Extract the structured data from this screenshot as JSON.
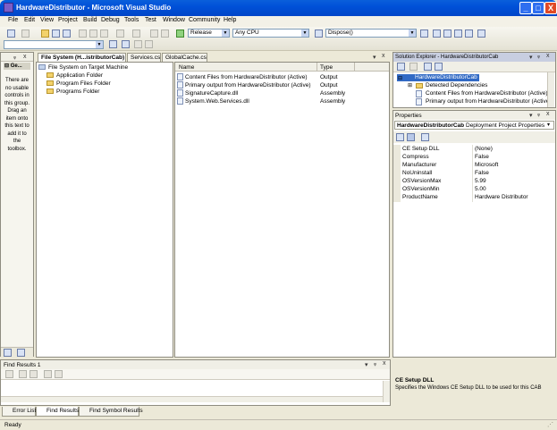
{
  "window": {
    "title": "HardwareDistributor - Microsoft Visual Studio",
    "minimize": "_",
    "maximize": "□",
    "close": "X"
  },
  "menu": [
    "File",
    "Edit",
    "View",
    "Project",
    "Build",
    "Debug",
    "Tools",
    "Test",
    "Window",
    "Community",
    "Help"
  ],
  "toolbar": {
    "configuration": "Release",
    "platform": "Any CPU",
    "find_value": "Dispose()"
  },
  "toolbox": {
    "tab_label": "Ge...",
    "empty_message": "There are no usable controls in this group. Drag an item onto this text to add it to the toolbox."
  },
  "editor_tabs": [
    {
      "label": "File System (H...istributorCab)"
    },
    {
      "label": "Services.cs"
    },
    {
      "label": "GlobalCache.cs"
    }
  ],
  "filesystem_tree": {
    "root": "File System on Target Machine",
    "children": [
      "Application Folder",
      "Program Files Folder",
      "Programs Folder"
    ]
  },
  "file_list": {
    "columns": [
      "Name",
      "Type"
    ],
    "rows": [
      {
        "name": "Content Files from HardwareDistributor (Active)",
        "type": "Output"
      },
      {
        "name": "Primary output from HardwareDistributor (Active)",
        "type": "Output"
      },
      {
        "name": "SignatureCapture.dll",
        "type": "Assembly"
      },
      {
        "name": "System.Web.Services.dll",
        "type": "Assembly"
      }
    ]
  },
  "solution_explorer": {
    "title": "Solution Explorer - HardwareDistributorCab",
    "project": "HardwareDistributorCab",
    "items": [
      "Detected Dependencies",
      "Content Files from HardwareDistributor (Active)",
      "Primary output from HardwareDistributor (Active)"
    ]
  },
  "properties": {
    "title": "Properties",
    "object_name": "HardwareDistributorCab",
    "object_type": "Deployment Project Properties",
    "rows": [
      {
        "name": "CE Setup DLL",
        "value": "(None)"
      },
      {
        "name": "Compress",
        "value": "False"
      },
      {
        "name": "Manufacturer",
        "value": "Microsoft"
      },
      {
        "name": "NoUninstall",
        "value": "False"
      },
      {
        "name": "OSVersionMax",
        "value": "5.99"
      },
      {
        "name": "OSVersionMin",
        "value": "5.00"
      },
      {
        "name": "ProductName",
        "value": "Hardware Distributor"
      }
    ],
    "description_title": "CE Setup DLL",
    "description_text": "Specifies the Windows CE Setup DLL to be used for this CAB"
  },
  "find_results": {
    "title": "Find Results 1"
  },
  "bottom_tabs": [
    {
      "label": "Error List"
    },
    {
      "label": "Find Results 1"
    },
    {
      "label": "Find Symbol Results"
    }
  ],
  "status": {
    "text": "Ready"
  },
  "pane_buttons": {
    "dropdown": "▾",
    "pin": "ᵩ",
    "close": "x"
  }
}
